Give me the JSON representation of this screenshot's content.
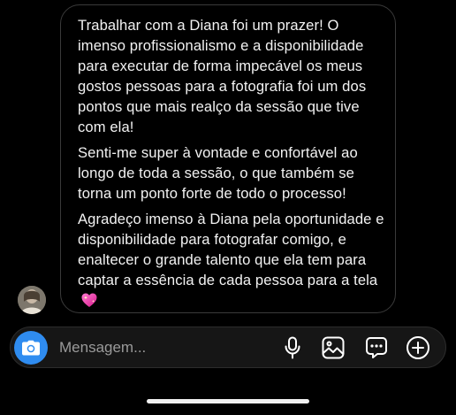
{
  "message": {
    "paragraphs": [
      "Trabalhar com a Diana foi um prazer! O imenso profissionalismo e a disponibilidade para executar de forma impecável os meus gostos pessoas para a fotografia foi um dos pontos que mais realço da sessão que tive com ela!",
      "Senti-me super à vontade e confortável ao longo de toda a sessão, o que também se torna um ponto forte de todo o processo!",
      "Agradeço imenso à Diana pela oportunidade e disponibilidade para fotografar comigo, e enaltecer o grande talento que ela tem para captar a essência de cada pessoa para a tela"
    ],
    "emoji_icon": "sparkling-heart-icon"
  },
  "composer": {
    "placeholder": "Mensagem...",
    "icons": [
      "camera-icon",
      "microphone-icon",
      "gallery-icon",
      "sticker-chat-icon",
      "plus-circle-icon"
    ]
  },
  "colors": {
    "accent": "#2f8cf0",
    "background": "#000000",
    "bubble_border": "#3a3a3a",
    "composer_bg": "#161616"
  }
}
